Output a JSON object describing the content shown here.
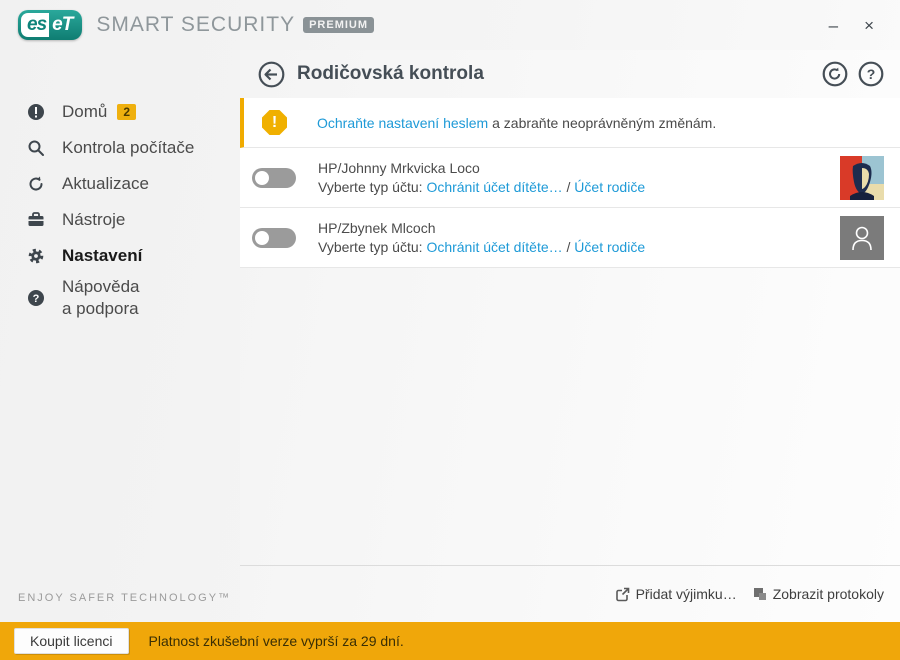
{
  "window": {
    "minimize": "–",
    "close": "×"
  },
  "brand": {
    "logo_es": "es",
    "logo_et": "eT",
    "product": "SMART SECURITY",
    "edition": "PREMIUM"
  },
  "sidebar": {
    "items": [
      {
        "label": "Domů",
        "badge": "2"
      },
      {
        "label": "Kontrola počítače"
      },
      {
        "label": "Aktualizace"
      },
      {
        "label": "Nástroje"
      },
      {
        "label": "Nastavení"
      },
      {
        "label_line1": "Nápověda",
        "label_line2": "a podpora"
      }
    ],
    "tagline": "ENJOY SAFER TECHNOLOGY™"
  },
  "header": {
    "title": "Rodičovská kontrola"
  },
  "banner": {
    "link": "Ochraňte nastavení heslem",
    "rest": " a zabraňte neoprávněným změnám."
  },
  "accounts": [
    {
      "name": "HP/Johnny Mrkvicka Loco",
      "prompt": "Vyberte typ účtu: ",
      "link1": "Ochránit účet dítěte…",
      "sep": " / ",
      "link2": "Účet rodiče"
    },
    {
      "name": "HP/Zbynek Mlcoch",
      "prompt": "Vyberte typ účtu: ",
      "link1": "Ochránit účet dítěte…",
      "sep": " / ",
      "link2": "Účet rodiče"
    }
  ],
  "footer": {
    "add_exclusion": "Přidat výjimku…",
    "show_logs": "Zobrazit protokoly"
  },
  "bottombar": {
    "buy_button": "Koupit licenci",
    "message": "Platnost zkušební verze vyprší za 29 dní."
  },
  "colors": {
    "accent_amber": "#f0ab00",
    "link_blue": "#1e9ad7",
    "eset_teal": "#14897e",
    "bottombar": "#f0a70a"
  }
}
